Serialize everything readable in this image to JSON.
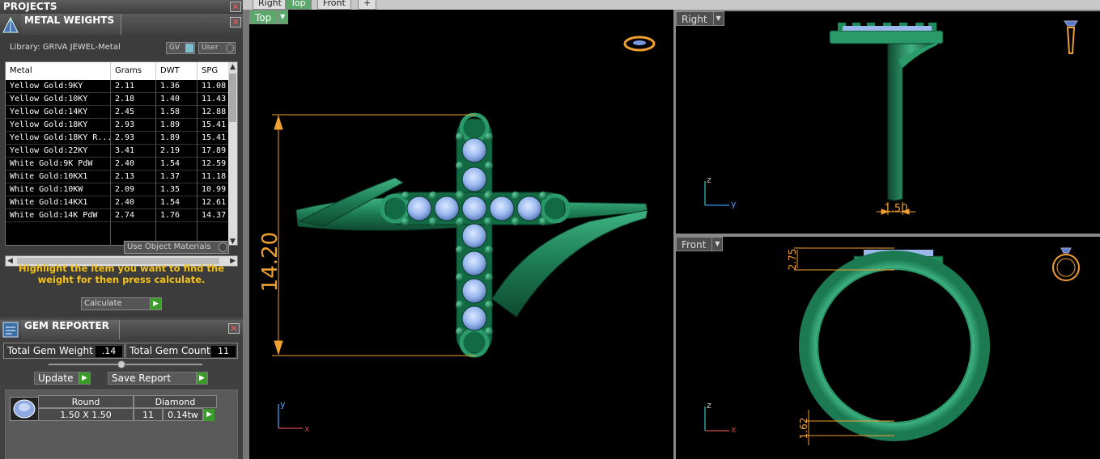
{
  "projects": {
    "title": "PROJECTS"
  },
  "metal_weights": {
    "title": "METAL WEIGHTS",
    "library_label": "Library: GRIVA JEWEL-Metal",
    "toggle_gv": "GV",
    "toggle_user": "User",
    "columns": [
      "Metal",
      "Grams",
      "DWT",
      "SPG"
    ],
    "rows": [
      [
        "Yellow Gold:9KY",
        "2.11",
        "1.36",
        "11.08"
      ],
      [
        "Yellow Gold:10KY",
        "2.18",
        "1.40",
        "11.43"
      ],
      [
        "Yellow Gold:14KY",
        "2.45",
        "1.58",
        "12.88"
      ],
      [
        "Yellow Gold:18KY",
        "2.93",
        "1.89",
        "15.41"
      ],
      [
        "Yellow Gold:18KY R...",
        "2.93",
        "1.89",
        "15.41"
      ],
      [
        "Yellow Gold:22KY",
        "3.41",
        "2.19",
        "17.89"
      ],
      [
        "White Gold:9K PdW",
        "2.40",
        "1.54",
        "12.59"
      ],
      [
        "White Gold:10KX1",
        "2.13",
        "1.37",
        "11.18"
      ],
      [
        "White Gold:10KW",
        "2.09",
        "1.35",
        "10.99"
      ],
      [
        "White Gold:14KX1",
        "2.40",
        "1.54",
        "12.61"
      ],
      [
        "White Gold:14K PdW",
        "2.74",
        "1.76",
        "14.37"
      ]
    ],
    "use_object_materials": "Use Object Materials",
    "hint": "Highlight the item you want to find the weight for then press calculate.",
    "calculate": "Calculate"
  },
  "gem_reporter": {
    "title": "GEM REPORTER",
    "total_weight_label": "Total Gem Weight",
    "total_weight_value": ".14",
    "total_count_label": "Total Gem Count",
    "total_count_value": "11",
    "update": "Update",
    "save_report": "Save Report",
    "gem": {
      "shape": "Round",
      "type": "Diamond",
      "size": "1.50 X 1.50",
      "count": "11",
      "weight": "0.14tw"
    }
  },
  "viewport_tabs": [
    "Right",
    "Top",
    "Front",
    "+"
  ],
  "viewports": {
    "top": {
      "label": "Top",
      "dimension": "14.20",
      "axis_y": "y",
      "axis_x": "x"
    },
    "right": {
      "label": "Right",
      "dimension": "1.50",
      "axis_z": "z",
      "axis_y": "y"
    },
    "front": {
      "label": "Front",
      "dimension_top": "2.75",
      "dimension_bottom": "1.62",
      "axis_z": "z",
      "axis_x": "x"
    }
  },
  "colors": {
    "accent_green": "#5aa86a",
    "metal": "#1e8c5a",
    "gem": "#9ab8ee",
    "dimension": "#f0a030",
    "hint": "#f5c21a"
  }
}
